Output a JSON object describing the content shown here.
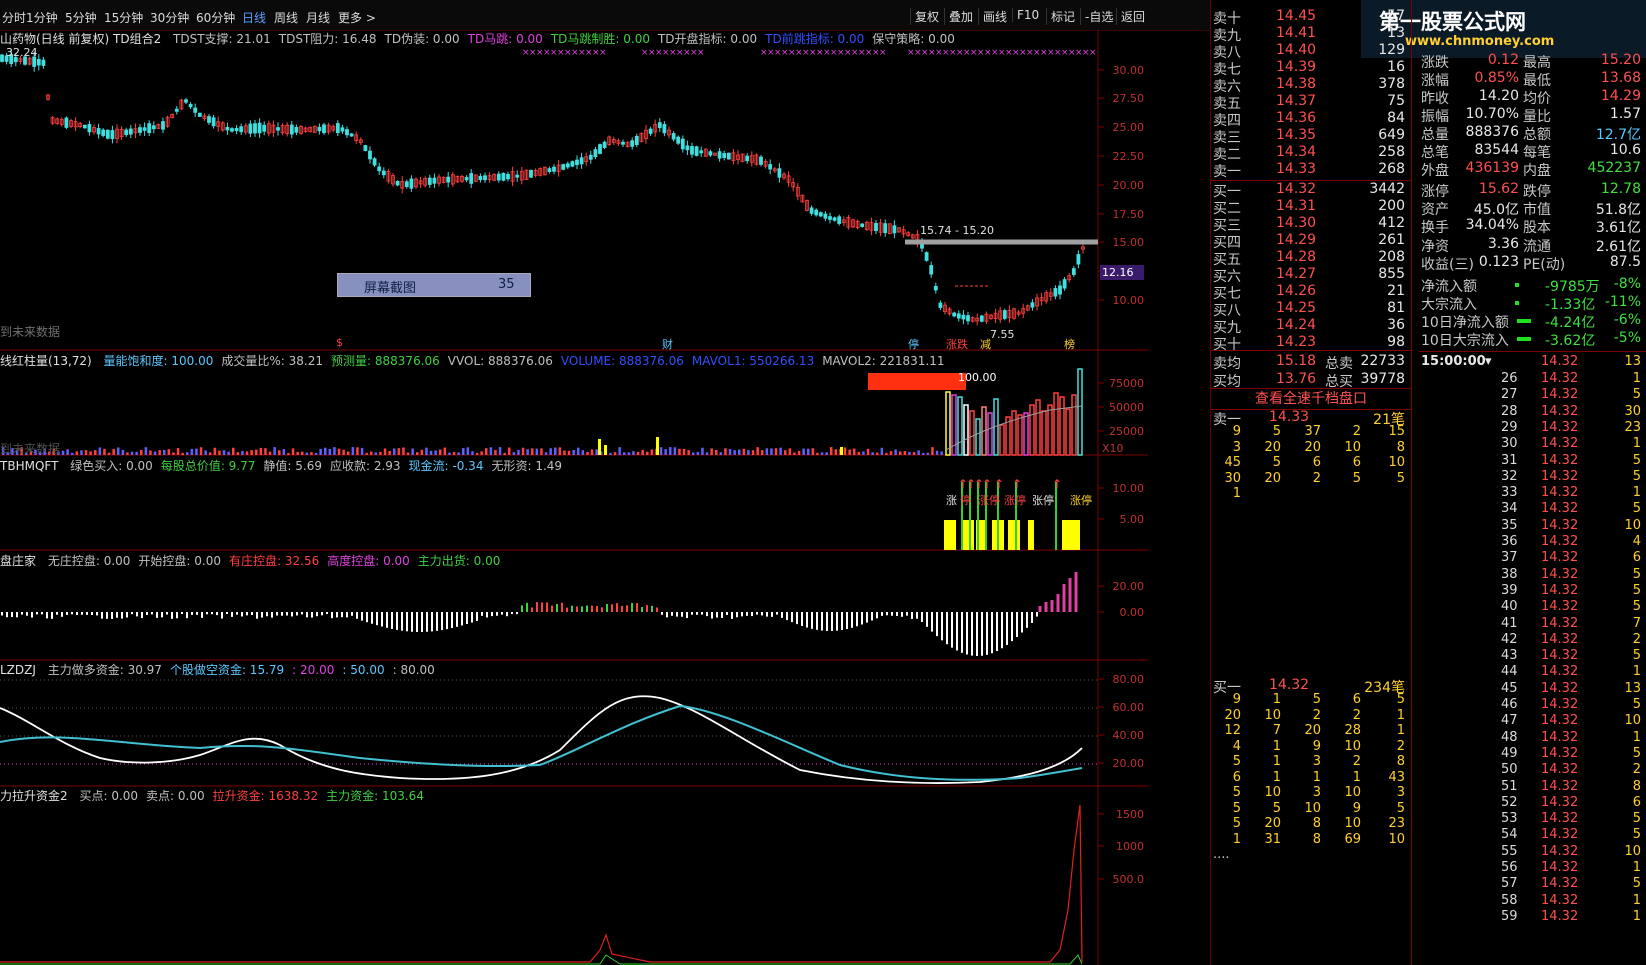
{
  "toolbar": {
    "periods": [
      "分时",
      "1分钟",
      "5分钟",
      "15分钟",
      "30分钟",
      "60分钟",
      "日线",
      "周线",
      "月线",
      "更多 >"
    ],
    "active_period": "日线",
    "buttons": [
      "复权",
      "叠加",
      "画线",
      "F10",
      "标记",
      "-自选",
      "返回"
    ]
  },
  "main_panel": {
    "stock_title": "山药物(日线 前复权) TD组合2",
    "indicators": [
      {
        "text": "TDST支撑: 21.01",
        "color": "#c0c0c0"
      },
      {
        "text": "TDST阻力: 16.48",
        "color": "#c0c0c0"
      },
      {
        "text": "TD伪装: 0.00",
        "color": "#c0c0c0"
      },
      {
        "text": "TD马跳: 0.00",
        "color": "#e040e0"
      },
      {
        "text": "TD马跳制胜: 0.00",
        "color": "#40d040"
      },
      {
        "text": "TD开盘指标: 0.00",
        "color": "#c0c0c0"
      },
      {
        "text": "TD前跳指标: 0.00",
        "color": "#3050ff"
      },
      {
        "text": "保守策略: 0.00",
        "color": "#c0c0c0"
      }
    ],
    "high_label": "32.24",
    "range_label": "15.74 - 15.20",
    "low_label": "7.55",
    "price_axis": [
      "30.00",
      "27.50",
      "25.00",
      "22.50",
      "20.00",
      "17.50",
      "15.00",
      "12.50",
      "10.00"
    ],
    "current_price": "12.16",
    "screenshot_box": {
      "label": "屏幕截图",
      "value": "35"
    },
    "future_text": "到未来数据",
    "markers": [
      "$",
      "财",
      "停",
      "涨跌",
      "减",
      "榜"
    ]
  },
  "vol_panel": {
    "title": "线红柱量(13,72)",
    "indicators": [
      {
        "text": "量能饱和度: 100.00",
        "color": "#5ac8ff"
      },
      {
        "text": "成交量比%: 38.21",
        "color": "#c0c0c0"
      },
      {
        "text": "预测量: 888376.06",
        "color": "#40d040"
      },
      {
        "text": "VVOL: 888376.06",
        "color": "#c0c0c0"
      },
      {
        "text": "VOLUME: 888376.06",
        "color": "#3050ff"
      },
      {
        "text": "MAVOL1: 550266.13",
        "color": "#3050ff"
      },
      {
        "text": "MAVOL2: 221831.11",
        "color": "#c0c0c0"
      }
    ],
    "box_label": "100.00",
    "axis": [
      "75000",
      "50000",
      "25000"
    ],
    "unit": "X10",
    "future_text": "到未来数据"
  },
  "fund_panel": {
    "title": "TBHMQFT",
    "indicators": [
      {
        "text": "绿色买入: 0.00",
        "color": "#c0c0c0"
      },
      {
        "text": "每股总价值: 9.77",
        "color": "#40d040"
      },
      {
        "text": "静值: 5.69",
        "color": "#c0c0c0"
      },
      {
        "text": "应收款: 2.93",
        "color": "#c0c0c0"
      },
      {
        "text": "现金流: -0.34",
        "color": "#5ac8ff"
      },
      {
        "text": "无形资: 1.49",
        "color": "#c0c0c0"
      }
    ],
    "axis": [
      "10.00",
      "5.00"
    ],
    "labels": [
      "涨",
      "停",
      "涨停",
      "涨停",
      "张停",
      "涨停"
    ]
  },
  "control_panel": {
    "title": "盘庄家",
    "indicators": [
      {
        "text": "无庄控盘: 0.00",
        "color": "#c0c0c0"
      },
      {
        "text": "开始控盘: 0.00",
        "color": "#c0c0c0"
      },
      {
        "text": "有庄控盘: 32.56",
        "color": "#ff4040"
      },
      {
        "text": "高度控盘: 0.00",
        "color": "#e040e0"
      },
      {
        "text": "主力出货: 0.00",
        "color": "#40d040"
      }
    ],
    "axis": [
      "20.00",
      "0.00"
    ]
  },
  "zdzj_panel": {
    "title": "LZDZJ",
    "indicators": [
      {
        "text": "主力做多资金: 30.97",
        "color": "#c0c0c0"
      },
      {
        "text": "个股做空资金: 15.79",
        "color": "#5ac8ff"
      },
      {
        "text": ": 20.00",
        "color": "#e040e0"
      },
      {
        "text": ": 50.00",
        "color": "#5ac8ff"
      },
      {
        "text": ": 80.00",
        "color": "#c0c0c0"
      }
    ],
    "axis": [
      "80.00",
      "60.00",
      "40.00",
      "20.00"
    ]
  },
  "lift_panel": {
    "title": "力拉升资金2",
    "indicators": [
      {
        "text": "买点: 0.00",
        "color": "#c0c0c0"
      },
      {
        "text": "卖点: 0.00",
        "color": "#c0c0c0"
      },
      {
        "text": "拉升资金: 1638.32",
        "color": "#ff4040"
      },
      {
        "text": "主力资金: 103.64",
        "color": "#40d040"
      }
    ],
    "axis": [
      "1500",
      "1000",
      "500.0"
    ]
  },
  "logo": {
    "line1": "第一股票公式网",
    "line2": "www.chnmoney.com"
  },
  "order_book": {
    "asks": [
      {
        "label": "卖十",
        "price": "14.45",
        "vol": "57"
      },
      {
        "label": "卖九",
        "price": "14.41",
        "vol": "13"
      },
      {
        "label": "卖八",
        "price": "14.40",
        "vol": "129"
      },
      {
        "label": "卖七",
        "price": "14.39",
        "vol": "16"
      },
      {
        "label": "卖六",
        "price": "14.38",
        "vol": "378"
      },
      {
        "label": "卖五",
        "price": "14.37",
        "vol": "75"
      },
      {
        "label": "卖四",
        "price": "14.36",
        "vol": "84"
      },
      {
        "label": "卖三",
        "price": "14.35",
        "vol": "649"
      },
      {
        "label": "卖二",
        "price": "14.34",
        "vol": "258"
      },
      {
        "label": "卖一",
        "price": "14.33",
        "vol": "268"
      }
    ],
    "bids": [
      {
        "label": "买一",
        "price": "14.32",
        "vol": "3442"
      },
      {
        "label": "买二",
        "price": "14.31",
        "vol": "200"
      },
      {
        "label": "买三",
        "price": "14.30",
        "vol": "412"
      },
      {
        "label": "买四",
        "price": "14.29",
        "vol": "261"
      },
      {
        "label": "买五",
        "price": "14.28",
        "vol": "208"
      },
      {
        "label": "买六",
        "price": "14.27",
        "vol": "855"
      },
      {
        "label": "买七",
        "price": "14.26",
        "vol": "21"
      },
      {
        "label": "买八",
        "price": "14.25",
        "vol": "81"
      },
      {
        "label": "买九",
        "price": "14.24",
        "vol": "36"
      },
      {
        "label": "买十",
        "price": "14.23",
        "vol": "98"
      }
    ],
    "avg_sell": {
      "label": "卖均",
      "price": "15.18",
      "tag": "总卖",
      "vol": "22733"
    },
    "avg_buy": {
      "label": "买均",
      "price": "13.76",
      "tag": "总买",
      "vol": "39778"
    },
    "view_all": "查看全速千档盘口",
    "sell1": {
      "label": "卖一",
      "price": "14.33",
      "count": "21笔"
    },
    "sell1_queue": [
      [
        "9",
        "5",
        "37",
        "2",
        "15"
      ],
      [
        "3",
        "20",
        "20",
        "10",
        "8"
      ],
      [
        "45",
        "5",
        "6",
        "6",
        "10"
      ],
      [
        "30",
        "20",
        "2",
        "5",
        "5"
      ],
      [
        "1",
        "",
        "",
        "",
        ""
      ]
    ],
    "buy1": {
      "label": "买一",
      "price": "14.32",
      "count": "234笔"
    },
    "buy1_queue": [
      [
        "9",
        "1",
        "5",
        "6",
        "5"
      ],
      [
        "20",
        "10",
        "2",
        "2",
        "1"
      ],
      [
        "12",
        "7",
        "20",
        "28",
        "1"
      ],
      [
        "4",
        "1",
        "9",
        "10",
        "2"
      ],
      [
        "5",
        "1",
        "3",
        "2",
        "8"
      ],
      [
        "6",
        "1",
        "1",
        "1",
        "43"
      ],
      [
        "5",
        "10",
        "3",
        "10",
        "3"
      ],
      [
        "5",
        "5",
        "10",
        "9",
        "5"
      ],
      [
        "5",
        "20",
        "8",
        "10",
        "23"
      ],
      [
        "1",
        "31",
        "8",
        "69",
        "10"
      ],
      [
        "....",
        "",
        "",
        "",
        ""
      ]
    ]
  },
  "stats": [
    {
      "a": "涨跌",
      "b": "0.12",
      "c": "最高",
      "d": "15.20"
    },
    {
      "a": "涨幅",
      "b": "0.85%",
      "c": "最低",
      "d": "13.68"
    },
    {
      "a": "昨收",
      "b": "14.20",
      "c": "均价",
      "d": "14.29"
    },
    {
      "a": "振幅",
      "b": "10.70%",
      "c": "量比",
      "d": "1.57"
    },
    {
      "a": "总量",
      "b": "888376",
      "c": "总额",
      "d": "12.7亿"
    },
    {
      "a": "总笔",
      "b": "83544",
      "c": "每笔",
      "d": "10.6"
    },
    {
      "a": "外盘",
      "b": "436139",
      "c": "内盘",
      "d": "452237"
    },
    {
      "a": "涨停",
      "b": "15.62",
      "c": "跌停",
      "d": "12.78"
    },
    {
      "a": "资产",
      "b": "45.0亿",
      "c": "市值",
      "d": "51.8亿"
    },
    {
      "a": "换手",
      "b": "34.04%",
      "c": "股本",
      "d": "3.61亿"
    },
    {
      "a": "净资",
      "b": "3.36",
      "c": "流通",
      "d": "2.61亿"
    },
    {
      "a": "收益(三)",
      "b": "0.123",
      "c": "PE(动)",
      "d": "87.5"
    }
  ],
  "flows": [
    {
      "label": "净流入额",
      "value": "-9785万",
      "pct": "-8%"
    },
    {
      "label": "大宗流入",
      "value": "-1.33亿",
      "pct": "-11%"
    },
    {
      "label": "10日净流入额",
      "value": "-4.24亿",
      "pct": "-6%"
    },
    {
      "label": "10日大宗流入",
      "value": "-3.62亿",
      "pct": "-5%"
    }
  ],
  "ticks_header": {
    "time": "15:00:00",
    "price": "14.32",
    "vol": "13"
  },
  "ticks": [
    {
      "t": "26",
      "p": "14.32",
      "v": "1"
    },
    {
      "t": "27",
      "p": "14.32",
      "v": "5"
    },
    {
      "t": "28",
      "p": "14.32",
      "v": "30"
    },
    {
      "t": "29",
      "p": "14.32",
      "v": "23"
    },
    {
      "t": "30",
      "p": "14.32",
      "v": "1"
    },
    {
      "t": "31",
      "p": "14.32",
      "v": "5"
    },
    {
      "t": "32",
      "p": "14.32",
      "v": "5"
    },
    {
      "t": "33",
      "p": "14.32",
      "v": "1"
    },
    {
      "t": "34",
      "p": "14.32",
      "v": "5"
    },
    {
      "t": "35",
      "p": "14.32",
      "v": "10"
    },
    {
      "t": "36",
      "p": "14.32",
      "v": "4"
    },
    {
      "t": "37",
      "p": "14.32",
      "v": "6"
    },
    {
      "t": "38",
      "p": "14.32",
      "v": "5"
    },
    {
      "t": "39",
      "p": "14.32",
      "v": "5"
    },
    {
      "t": "40",
      "p": "14.32",
      "v": "5"
    },
    {
      "t": "41",
      "p": "14.32",
      "v": "7"
    },
    {
      "t": "42",
      "p": "14.32",
      "v": "2"
    },
    {
      "t": "43",
      "p": "14.32",
      "v": "5"
    },
    {
      "t": "44",
      "p": "14.32",
      "v": "1"
    },
    {
      "t": "45",
      "p": "14.32",
      "v": "13"
    },
    {
      "t": "46",
      "p": "14.32",
      "v": "5"
    },
    {
      "t": "47",
      "p": "14.32",
      "v": "10"
    },
    {
      "t": "48",
      "p": "14.32",
      "v": "1"
    },
    {
      "t": "49",
      "p": "14.32",
      "v": "5"
    },
    {
      "t": "50",
      "p": "14.32",
      "v": "2"
    },
    {
      "t": "51",
      "p": "14.32",
      "v": "8"
    },
    {
      "t": "52",
      "p": "14.32",
      "v": "6"
    },
    {
      "t": "53",
      "p": "14.32",
      "v": "5"
    },
    {
      "t": "54",
      "p": "14.32",
      "v": "5"
    },
    {
      "t": "55",
      "p": "14.32",
      "v": "10"
    },
    {
      "t": "56",
      "p": "14.32",
      "v": "1"
    },
    {
      "t": "57",
      "p": "14.32",
      "v": "5"
    },
    {
      "t": "58",
      "p": "14.32",
      "v": "1"
    },
    {
      "t": "59",
      "p": "14.32",
      "v": "1"
    }
  ],
  "colors": {
    "up": "#ff4040",
    "down": "#40e0e0",
    "yellow": "#ffff00",
    "magenta": "#e040e0",
    "green": "#40d040",
    "axis": "#800000"
  }
}
